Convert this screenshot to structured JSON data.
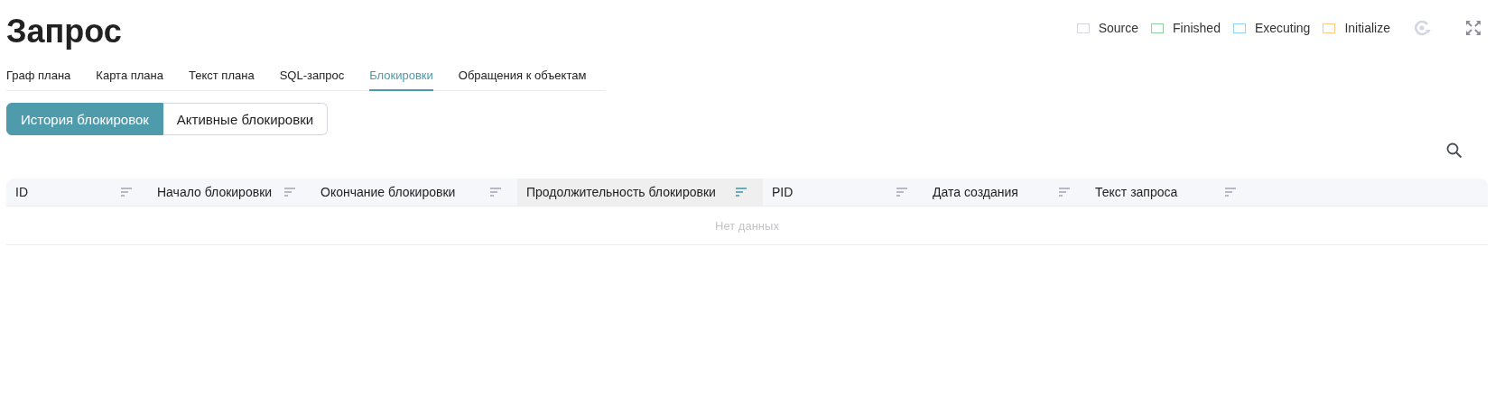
{
  "title": "Запрос",
  "legend": [
    {
      "label": "Source",
      "color": "#d3d6e2"
    },
    {
      "label": "Finished",
      "color": "#8fd19e"
    },
    {
      "label": "Executing",
      "color": "#8fd3f5"
    },
    {
      "label": "Initialize",
      "color": "#fcc98a"
    }
  ],
  "tabs": [
    {
      "label": "Граф плана",
      "selected": false
    },
    {
      "label": "Карта плана",
      "selected": false
    },
    {
      "label": "Текст плана",
      "selected": false
    },
    {
      "label": "SQL-запрос",
      "selected": false
    },
    {
      "label": "Блокировки",
      "selected": true
    },
    {
      "label": "Обращения к объектам",
      "selected": false
    }
  ],
  "segments": [
    {
      "label": "История блокировок",
      "selected": true
    },
    {
      "label": "Активные блокировки",
      "selected": false
    }
  ],
  "table": {
    "columns": [
      {
        "label": "ID",
        "sorted": false
      },
      {
        "label": "Начало блокировки",
        "sorted": false
      },
      {
        "label": "Окончание блокировки",
        "sorted": false
      },
      {
        "label": "Продолжительность блокировки",
        "sorted": true
      },
      {
        "label": "PID",
        "sorted": false
      },
      {
        "label": "Дата создания",
        "sorted": false
      },
      {
        "label": "Текст запроса",
        "sorted": false
      }
    ],
    "empty_text": "Нет данных"
  }
}
